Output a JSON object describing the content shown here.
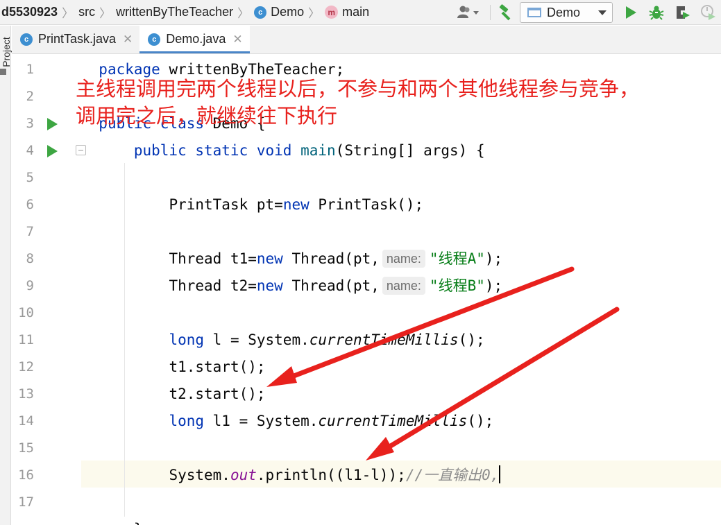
{
  "breadcrumb": {
    "project": "d5530923",
    "src": "src",
    "package": "writtenByTheTeacher",
    "class": "Demo",
    "method": "main",
    "class_icon": "class-icon",
    "method_icon": "method-icon"
  },
  "toolbar": {
    "run_config": "Demo",
    "icons": [
      "user-icon",
      "build-hammer-icon",
      "run-icon",
      "debug-icon",
      "coverage-icon",
      "profiler-icon"
    ]
  },
  "side_strip": {
    "project_tab": "Project"
  },
  "tabs": [
    {
      "label": "PrintTask.java",
      "active": false
    },
    {
      "label": "Demo.java",
      "active": true
    }
  ],
  "gutter": {
    "line_numbers": [
      "1",
      "2",
      "3",
      "4",
      "5",
      "6",
      "7",
      "8",
      "9",
      "10",
      "11",
      "12",
      "13",
      "14",
      "15",
      "16",
      "17"
    ]
  },
  "code": {
    "l1_kw": "package",
    "l1_rest": " writtenByTheTeacher;",
    "l3_kw": "public class",
    "l3_rest": " Demo {",
    "l4_kw": "public static void",
    "l4_method": "main",
    "l4_rest": "(String[] args) {",
    "l6_a": "PrintTask pt=",
    "l6_kw": "new",
    "l6_b": " PrintTask();",
    "l8_a": "Thread t1=",
    "l8_kw": "new",
    "l8_b": " Thread(pt,",
    "l8_hint": "name:",
    "l8_str": "\"线程A\"",
    "l8_c": ");",
    "l9_a": "Thread t2=",
    "l9_kw": "new",
    "l9_b": " Thread(pt,",
    "l9_hint": "name:",
    "l9_str": "\"线程B\"",
    "l9_c": ");",
    "l11_kw": "long",
    "l11_a": " l = System.",
    "l11_it": "currentTimeMillis",
    "l11_b": "();",
    "l12": "t1.start();",
    "l13": "t2.start();",
    "l14_kw": "long",
    "l14_a": " l1 = System.",
    "l14_it": "currentTimeMillis",
    "l14_b": "();",
    "l16_a": "System.",
    "l16_field": "out",
    "l16_b": ".println((l1-l));",
    "l16_cmt": "//一直输出0,",
    "l18": "}"
  },
  "annotation": {
    "line1": "主线程调用完两个线程以后，不参与和两个其他线程参与竞争，",
    "line2": "调用完之后，就继续往下执行",
    "color": "#e8211d"
  },
  "colors": {
    "keyword": "#0033b3",
    "string": "#067d17",
    "field": "#871094",
    "comment": "#8c8c8c",
    "run_green": "#3da642",
    "tab_underline": "#4a86c8"
  }
}
